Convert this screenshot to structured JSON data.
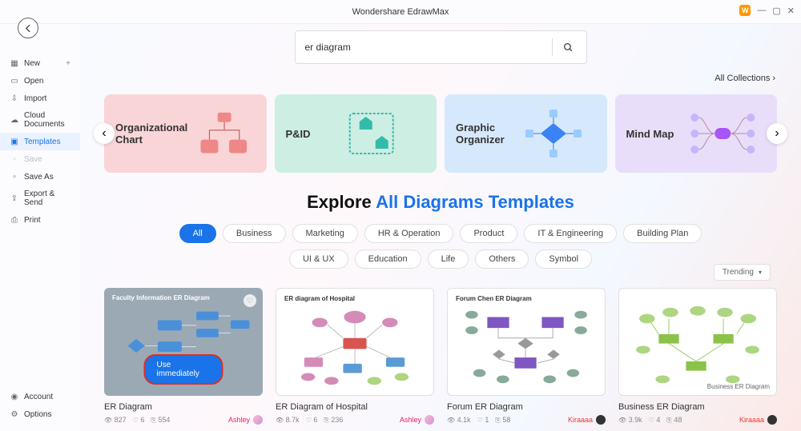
{
  "app_title": "Wondershare EdrawMax",
  "brand_letter": "W",
  "sidebar": {
    "new": "New",
    "open": "Open",
    "import": "Import",
    "cloud": "Cloud Documents",
    "templates": "Templates",
    "save": "Save",
    "saveas": "Save As",
    "export": "Export & Send",
    "print": "Print",
    "account": "Account",
    "options": "Options"
  },
  "search": {
    "value": "er diagram"
  },
  "collections_link": "All Collections",
  "categories": [
    {
      "title": "Organizational\nChart"
    },
    {
      "title": "P&ID"
    },
    {
      "title": "Graphic\nOrganizer"
    },
    {
      "title": "Mind Map"
    }
  ],
  "explore": {
    "prefix": "Explore ",
    "suffix": "All Diagrams Templates"
  },
  "chips_row1": [
    "All",
    "Business",
    "Marketing",
    "HR & Operation",
    "Product",
    "IT & Engineering",
    "Building Plan"
  ],
  "chips_row2": [
    "UI & UX",
    "Education",
    "Life",
    "Others",
    "Symbol"
  ],
  "trending_label": "Trending",
  "templates": [
    {
      "thumb_title": "Faculty Information ER Diagram",
      "use_label": "Use immediately",
      "name": "ER Diagram",
      "views": "827",
      "likes": "6",
      "copies": "554",
      "author": "Ashley",
      "author_style": "ashley",
      "avatar": "pink"
    },
    {
      "thumb_title": "ER diagram of Hospital",
      "name": "ER Diagram of Hospital",
      "views": "8.7k",
      "likes": "6",
      "copies": "236",
      "author": "Ashley",
      "author_style": "ashley",
      "avatar": "pink"
    },
    {
      "thumb_title": "Forum Chen ER Diagram",
      "name": "Forum ER Diagram",
      "views": "4.1k",
      "likes": "1",
      "copies": "58",
      "author": "Kiraaaa",
      "author_style": "kiraaaa",
      "avatar": "dark"
    },
    {
      "thumb_title": "",
      "bottom_right_label": "Business ER Diagram",
      "name": "Business ER Diagram",
      "views": "3.9k",
      "likes": "4",
      "copies": "48",
      "author": "Kiraaaa",
      "author_style": "kiraaaa",
      "avatar": "dark"
    }
  ]
}
